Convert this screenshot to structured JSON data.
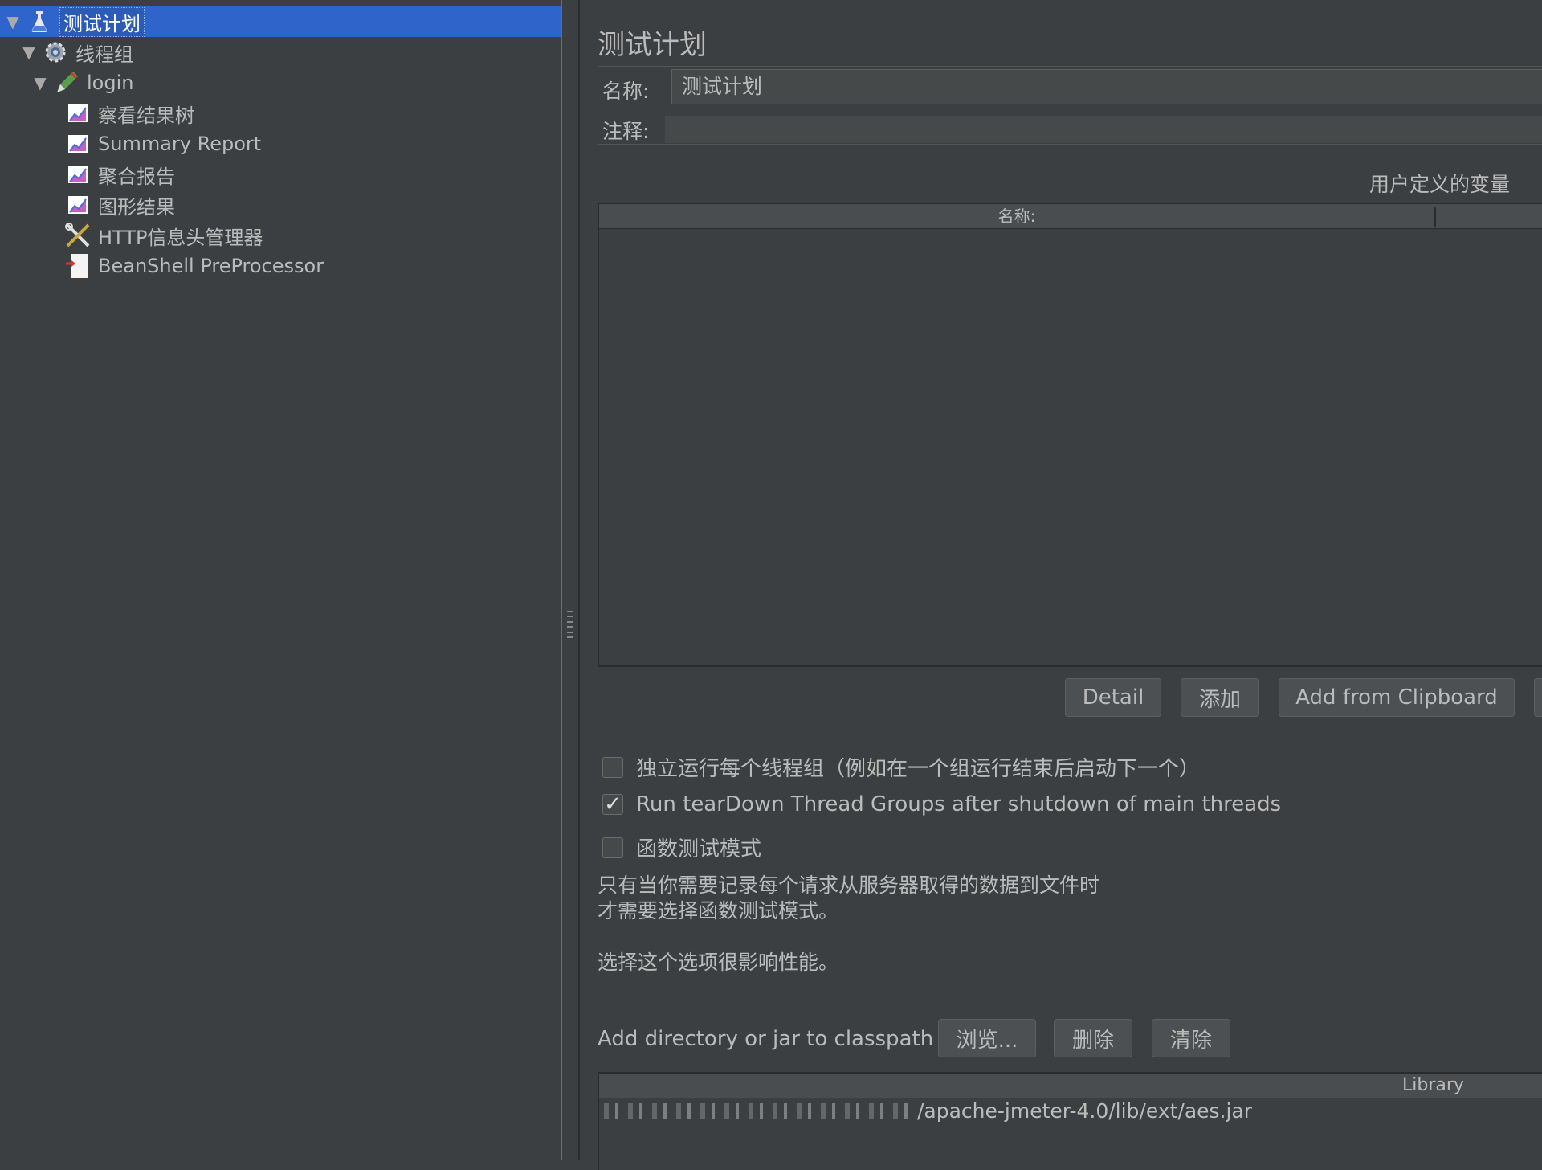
{
  "tree": {
    "items": [
      {
        "label": "测试计划",
        "icon": "test-plan-icon"
      },
      {
        "label": "线程组",
        "icon": "gear-icon"
      },
      {
        "label": "login",
        "icon": "sampler-pen-icon"
      },
      {
        "label": "察看结果树",
        "icon": "listener-chart-icon"
      },
      {
        "label": "Summary Report",
        "icon": "listener-chart-icon"
      },
      {
        "label": "聚合报告",
        "icon": "listener-chart-icon"
      },
      {
        "label": "图形结果",
        "icon": "listener-chart-icon"
      },
      {
        "label": "HTTP信息头管理器",
        "icon": "config-tools-icon"
      },
      {
        "label": "BeanShell PreProcessor",
        "icon": "preprocessor-icon"
      }
    ]
  },
  "main": {
    "title": "测试计划",
    "name_label": "名称:",
    "name_value": "测试计划",
    "comment_label": "注释:",
    "vars_label": "用户定义的变量",
    "table_col_name": "名称:",
    "buttons": {
      "detail": "Detail",
      "add": "添加",
      "add_clipboard": "Add from Clipboard"
    },
    "checks": [
      {
        "label": "独立运行每个线程组（例如在一个组运行结束后启动下一个）",
        "checked": false
      },
      {
        "label": "Run tearDown Thread Groups after shutdown of main threads",
        "checked": true
      },
      {
        "label": "函数测试模式",
        "checked": false
      }
    ],
    "note_line1": "只有当你需要记录每个请求从服务器取得的数据到文件时",
    "note_line2": "才需要选择函数测试模式。",
    "note_line3": "选择这个选项很影响性能。",
    "classpath_label": "Add directory or jar to classpath",
    "classpath_buttons": {
      "browse": "浏览...",
      "delete": "删除",
      "clear": "清除"
    },
    "library_header": "Library",
    "library_row": "/apache-jmeter-4.0/lib/ext/aes.jar"
  },
  "colors": {
    "background": "#3c3f41",
    "selection": "#2f65ca",
    "text": "#bbbbbb"
  }
}
